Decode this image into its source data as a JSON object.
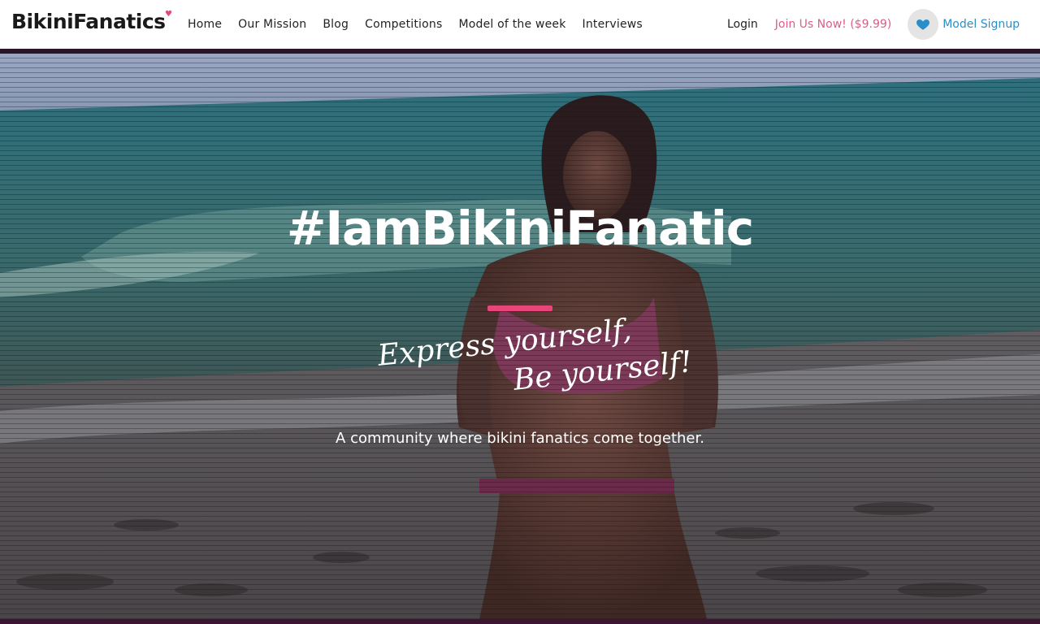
{
  "brand": {
    "name": "BikiniFanatics",
    "accent_color": "#e8457a"
  },
  "nav": {
    "items": [
      {
        "label": "Home"
      },
      {
        "label": "Our Mission"
      },
      {
        "label": "Blog"
      },
      {
        "label": "Competitions"
      },
      {
        "label": "Model of the week"
      },
      {
        "label": "Interviews"
      }
    ]
  },
  "account": {
    "login": "Login",
    "join": "Join Us Now! ($9.99)",
    "join_color": "#e05a8a",
    "signup_icon": "heart-icon",
    "signup": "Model Signup",
    "signup_color": "#2a8fc9"
  },
  "hero": {
    "hashtag": "#IamBikiniFanatic",
    "script_line1": "Express yourself,",
    "script_line2": "Be yourself!",
    "tagline": "A community where bikini fanatics come together."
  }
}
